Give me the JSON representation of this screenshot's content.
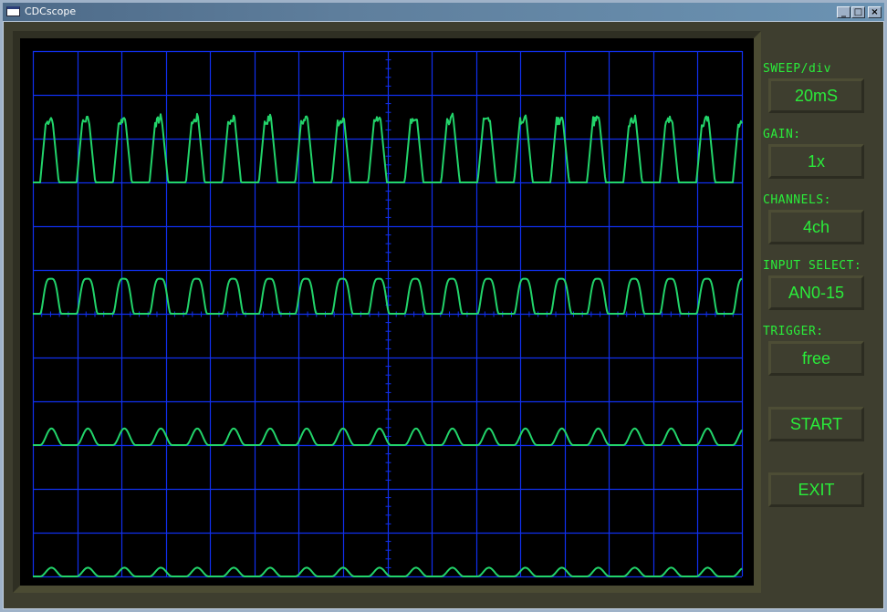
{
  "window": {
    "title": "CDCscope",
    "controls": {
      "minimize": "_",
      "maximize": "□",
      "close": "×"
    }
  },
  "panel": {
    "sweep": {
      "label": "SWEEP/div",
      "value": "20mS"
    },
    "gain": {
      "label": "GAIN:",
      "value": "1x"
    },
    "channels": {
      "label": "CHANNELS:",
      "value": "4ch"
    },
    "input_select": {
      "label": "INPUT SELECT:",
      "value": "AN0-15"
    },
    "trigger": {
      "label": "TRIGGER:",
      "value": "free"
    },
    "start_label": "START",
    "exit_label": "EXIT"
  },
  "colors": {
    "trace": "#22d46a",
    "grid": "#1030f0",
    "text": "#2aec3a",
    "panel_bg": "#3e3e2f"
  },
  "scope": {
    "grid": {
      "h_divisions": 16,
      "v_divisions": 12,
      "minor_ticks_per_div": 5
    },
    "channels": [
      {
        "name": "ch1",
        "shape": "flat-top pulse",
        "baseline_div": 3,
        "amplitude_div": 1.5,
        "cycles": 19,
        "noise": true
      },
      {
        "name": "ch2",
        "shape": "rounded pulse",
        "baseline_div": 6,
        "amplitude_div": 0.8,
        "cycles": 19,
        "noise": false
      },
      {
        "name": "ch3",
        "shape": "sine bump",
        "baseline_div": 9,
        "amplitude_div": 0.38,
        "cycles": 19,
        "noise": false
      },
      {
        "name": "ch4",
        "shape": "small sine bump",
        "baseline_div": 12,
        "amplitude_div": 0.2,
        "cycles": 19,
        "noise": false
      }
    ]
  }
}
